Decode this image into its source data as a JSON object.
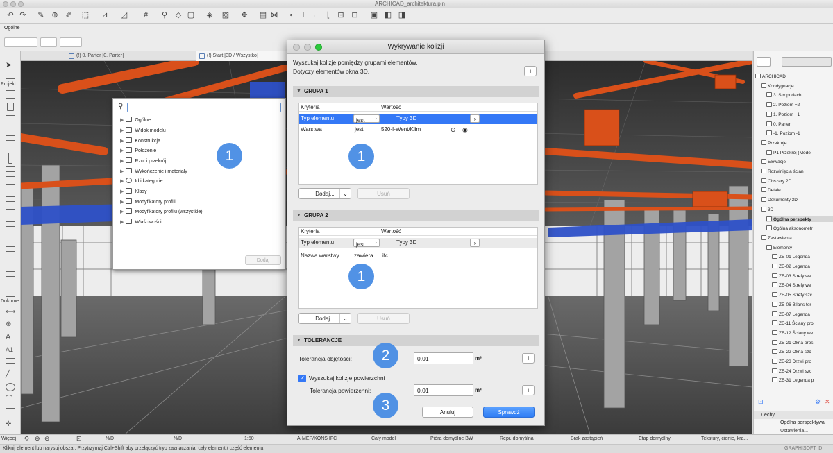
{
  "app": {
    "window_title": "ARCHICAD_architektura.pln",
    "infobox_label": "Ogólne"
  },
  "tabs": [
    {
      "label": "(!) 0. Parter [0. Parter]"
    },
    {
      "label": "(!) Start [3D / Wszystko]"
    }
  ],
  "toolbox": {
    "projekt_label": "Projekt",
    "dokument_label": "Dokume",
    "wiecej_label": "Więcej"
  },
  "filter_panel": {
    "search_value": "",
    "items": [
      {
        "label": "Ogólne"
      },
      {
        "label": "Widok modelu"
      },
      {
        "label": "Konstrukcja"
      },
      {
        "label": "Położenie"
      },
      {
        "label": "Rzut i przekrój"
      },
      {
        "label": "Wykończenie i materiały"
      },
      {
        "label": "Id i kategorie"
      },
      {
        "label": "Klasy"
      },
      {
        "label": "Modyfikatory profili"
      },
      {
        "label": "Modyfikatory profilu (wszystkie)"
      },
      {
        "label": "Właściwości"
      }
    ],
    "add_label": "Dodaj"
  },
  "dialog": {
    "title": "Wykrywanie kolizji",
    "desc_line1": "Wyszukaj kolizje pomiędzy grupami elementów.",
    "desc_line2": "Dotyczy elementów okna 3D.",
    "info_symbol": "i",
    "group1": {
      "title": "GRUPA 1",
      "col_criteria": "Kryteria",
      "col_value": "Wartość",
      "rows": [
        {
          "criterion": "Typ elementu",
          "operator": "jest",
          "value": "Typy 3D"
        },
        {
          "criterion": "Warstwa",
          "operator": "jest",
          "value": "520-I-Went/Klim"
        }
      ],
      "add_label": "Dodaj...",
      "remove_label": "Usuń"
    },
    "group2": {
      "title": "GRUPA 2",
      "col_criteria": "Kryteria",
      "col_value": "Wartość",
      "rows": [
        {
          "criterion": "Typ elementu",
          "operator": "jest",
          "value": "Typy 3D"
        },
        {
          "criterion": "Nazwa warstwy",
          "operator": "zawiera",
          "value": "ifc"
        }
      ],
      "add_label": "Dodaj...",
      "remove_label": "Usuń"
    },
    "tolerances": {
      "title": "TOLERANCJE",
      "volume_label": "Tolerancja objętości:",
      "volume_value": "0,01",
      "volume_unit": "m³",
      "surface_check_label": "Wyszukaj kolizje powierzchni",
      "surface_checked": true,
      "surface_label": "Tolerancja powierzchni:",
      "surface_value": "0,01",
      "surface_unit": "m²"
    },
    "cancel_label": "Anuluj",
    "check_label": "Sprawdź"
  },
  "badges": {
    "b1": "1",
    "b2": "1",
    "b3": "1",
    "b4": "2",
    "b5": "3"
  },
  "navigator": {
    "items": [
      {
        "label": "ARCHICAD"
      },
      {
        "label": "Kondygnacje"
      },
      {
        "label": "3. Stropodach"
      },
      {
        "label": "2. Poziom +2"
      },
      {
        "label": "1. Poziom +1"
      },
      {
        "label": "0. Parter"
      },
      {
        "label": "-1. Poziom -1"
      },
      {
        "label": "Przekroje"
      },
      {
        "label": "P1 Przekrój (Model"
      },
      {
        "label": "Elewacje"
      },
      {
        "label": "Rozwinięcia ścian"
      },
      {
        "label": "Obszary 2D"
      },
      {
        "label": "Detale"
      },
      {
        "label": "Dokumenty 3D"
      },
      {
        "label": "3D"
      },
      {
        "label": "Ogólna perspekty"
      },
      {
        "label": "Ogólna aksonometr"
      },
      {
        "label": "Zestawienia"
      },
      {
        "label": "Elementy"
      },
      {
        "label": "ZE-01 Legenda"
      },
      {
        "label": "ZE-02 Legenda"
      },
      {
        "label": "ZE-03 Strefy we"
      },
      {
        "label": "ZE-04 Strefy we"
      },
      {
        "label": "ZE-05 Strefy szc"
      },
      {
        "label": "ZE-06 Bilans ter"
      },
      {
        "label": "ZE-07 Legenda"
      },
      {
        "label": "ZE-11 Ściany pro"
      },
      {
        "label": "ZE-12 Ściany we"
      },
      {
        "label": "ZE-21 Okna pros"
      },
      {
        "label": "ZE-22 Okna szc"
      },
      {
        "label": "ZE-23 Drzwi pro"
      },
      {
        "label": "ZE-24 Drzwi szc"
      },
      {
        "label": "ZE-31 Legenda p"
      }
    ],
    "cechy_label": "Cechy",
    "cechy_value": "Ogólna perspektywa",
    "ustawienia_label": "Ustawienia..."
  },
  "statusbar": {
    "nd1": "N/D",
    "nd2": "N/D",
    "scale": "1:50",
    "layer": "A-MEP/KONS IFC",
    "model": "Cały model",
    "pens": "Pióra domyślne BW",
    "repr": "Repr. domyślna",
    "override": "Brak zastąpień",
    "phase": "Etap domyślny",
    "textures": "Tekstury, cienie, kra...",
    "hint": "Kliknij element lub narysuj obszar. Przytrzymaj Ctrl+Shift aby przełączyć tryb zaznaczania: cały element / część elementu.",
    "brand": "GRAPHISOFT ID"
  }
}
